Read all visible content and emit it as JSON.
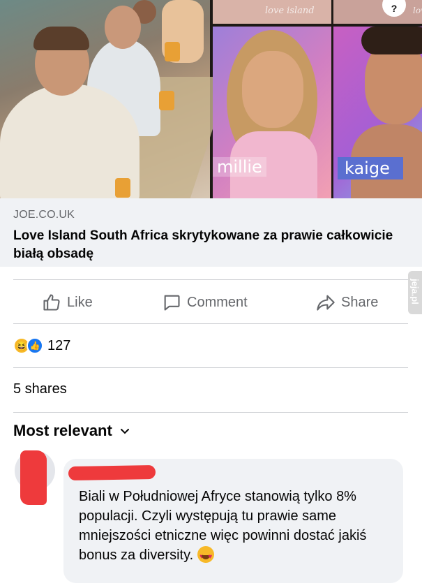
{
  "hero": {
    "left_caption_name": "millie",
    "right_caption_name": "kaige",
    "top_logo_text": "love island",
    "top_logo_text_2": "lov"
  },
  "link": {
    "domain": "JOE.CO.UK",
    "title": "Love Island South Africa skrytykowane za prawie całkowicie białą obsadę"
  },
  "actions": {
    "like": "Like",
    "comment": "Comment",
    "share": "Share"
  },
  "side_tab": {
    "text": "jeja.pl"
  },
  "reactions": {
    "count": "127"
  },
  "shares": "5 shares",
  "comments_sort": "Most relevant",
  "comment": {
    "text": "Biali w Południowej Afryce stanowią tylko 8% populacji. Czyli występują tu prawie same mniejszości etniczne więc powinni dostać jakiś bonus za diversity."
  },
  "colors": {
    "redaction": "#ee3a3c",
    "secondary_text": "#65676b",
    "bubble_bg": "#f0f2f5",
    "like_blue": "#1877f2"
  },
  "icons": [
    "thumbs-up-icon",
    "comment-icon",
    "share-arrow-icon",
    "chevron-down-icon",
    "haha-emoji-icon",
    "like-emoji-icon",
    "heart-eyes-emoji-icon"
  ]
}
